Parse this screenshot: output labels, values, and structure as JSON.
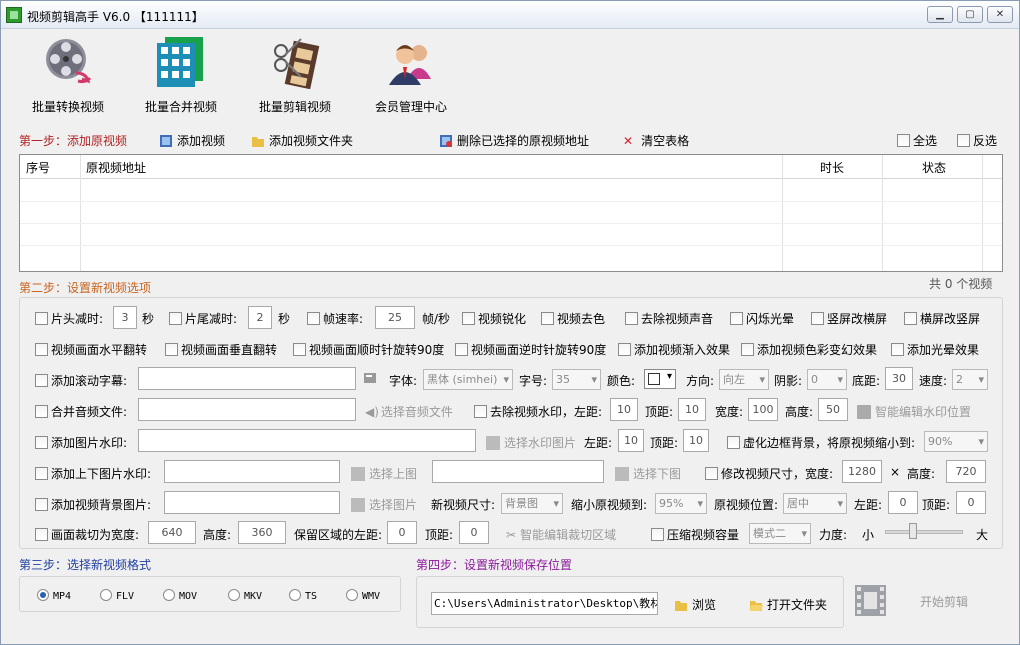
{
  "title": "视频剪辑高手 V6.0  【111111】",
  "window_buttons": [
    "▁",
    "▢",
    "✕"
  ],
  "toolbar": {
    "batch_convert": "批量转换视频",
    "batch_merge": "批量合并视频",
    "batch_edit": "批量剪辑视频",
    "member": "会员管理中心"
  },
  "step1": {
    "label": "第一步：添加原视频",
    "add_video": "添加视频",
    "add_folder": "添加视频文件夹",
    "delete_selected": "删除已选择的原视频地址",
    "clear_table": "清空表格",
    "select_all": "全选",
    "invert": "反选"
  },
  "table": {
    "columns": [
      "序号",
      "原视频地址",
      "时长",
      "状态"
    ],
    "rows": [],
    "count_text": "共 0 个视频"
  },
  "step2": {
    "label": "第二步：设置新视频选项"
  },
  "row1": {
    "head_cut": "片头减时:",
    "head_val": "3",
    "sec1": "秒",
    "tail_cut": "片尾减时:",
    "tail_val": "2",
    "sec2": "秒",
    "fps": "帧速率:",
    "fps_val": "25",
    "fps_unit": "帧/秒",
    "sharpen": "视频锐化",
    "decolor": "视频去色",
    "mute": "去除视频声音",
    "flash": "闪烁光晕",
    "v2h": "竖屏改横屏",
    "h2v": "横屏改竖屏"
  },
  "row2": {
    "hflip": "视频画面水平翻转",
    "vflip": "视频画面垂直翻转",
    "cw90": "视频画面顺时针旋转90度",
    "ccw90": "视频画面逆时针旋转90度",
    "fadein": "添加视频渐入效果",
    "color_fx": "添加视频色彩变幻效果",
    "halo": "添加光晕效果"
  },
  "row3": {
    "scroll_sub": "添加滚动字幕:",
    "font": "字体:",
    "font_val": "黑体 (simhei)",
    "size": "字号:",
    "size_val": "35",
    "color": "颜色:",
    "dir": "方向:",
    "dir_val": "向左",
    "shadow": "阴影:",
    "shadow_val": "0",
    "bottom": "底距:",
    "bottom_val": "30",
    "speed": "速度:",
    "speed_val": "2"
  },
  "row4": {
    "merge_audio": "合并音频文件:",
    "choose_audio": "选择音频文件",
    "remove_wm": "去除视频水印，左距:",
    "left_val": "10",
    "top": "顶距:",
    "top_val": "10",
    "width": "宽度:",
    "width_val": "100",
    "height": "高度:",
    "height_val": "50",
    "smart_wm": "智能编辑水印位置"
  },
  "row5": {
    "img_wm": "添加图片水印:",
    "choose_wm": "选择水印图片",
    "left": "左距:",
    "left_val": "10",
    "top": "顶距:",
    "top_val": "10",
    "blur_bg": "虚化边框背景，将原视频缩小到:",
    "scale_val": "90%"
  },
  "row6": {
    "tb_wm": "添加上下图片水印:",
    "choose_top": "选择上图",
    "choose_bottom": "选择下图",
    "resize": "修改视频尺寸，宽度:",
    "w_val": "1280",
    "x": "×",
    "height": "高度:",
    "h_val": "720"
  },
  "row7": {
    "bg_img": "添加视频背景图片:",
    "choose_img": "选择图片",
    "new_size": "新视频尺寸:",
    "new_size_val": "背景图",
    "shrink": "缩小原视频到:",
    "shrink_val": "95%",
    "pos": "原视频位置:",
    "pos_val": "居中",
    "left": "左距:",
    "left_val": "0",
    "top": "顶距:",
    "top_val": "0"
  },
  "row8": {
    "crop": "画面裁切为宽度:",
    "crop_w": "640",
    "height": "高度:",
    "crop_h": "360",
    "keep": "保留区域的左距:",
    "keep_l": "0",
    "top": "顶距:",
    "keep_t": "0",
    "smart_crop": "智能编辑裁切区域",
    "compress": "压缩视频容量",
    "mode_val": "模式二",
    "strength": "力度:",
    "small": "小",
    "big": "大"
  },
  "strength_level": 0.33,
  "step3": {
    "label": "第三步：选择新视频格式",
    "formats": [
      "MP4",
      "FLV",
      "MOV",
      "MKV",
      "TS",
      "WMV"
    ],
    "selected": "MP4"
  },
  "step4": {
    "label": "第四步：设置新视频保存位置",
    "path": "C:\\Users\\Administrator\\Desktop\\教材\\教",
    "browse": "浏览",
    "open_folder": "打开文件夹",
    "start": "开始剪辑"
  }
}
